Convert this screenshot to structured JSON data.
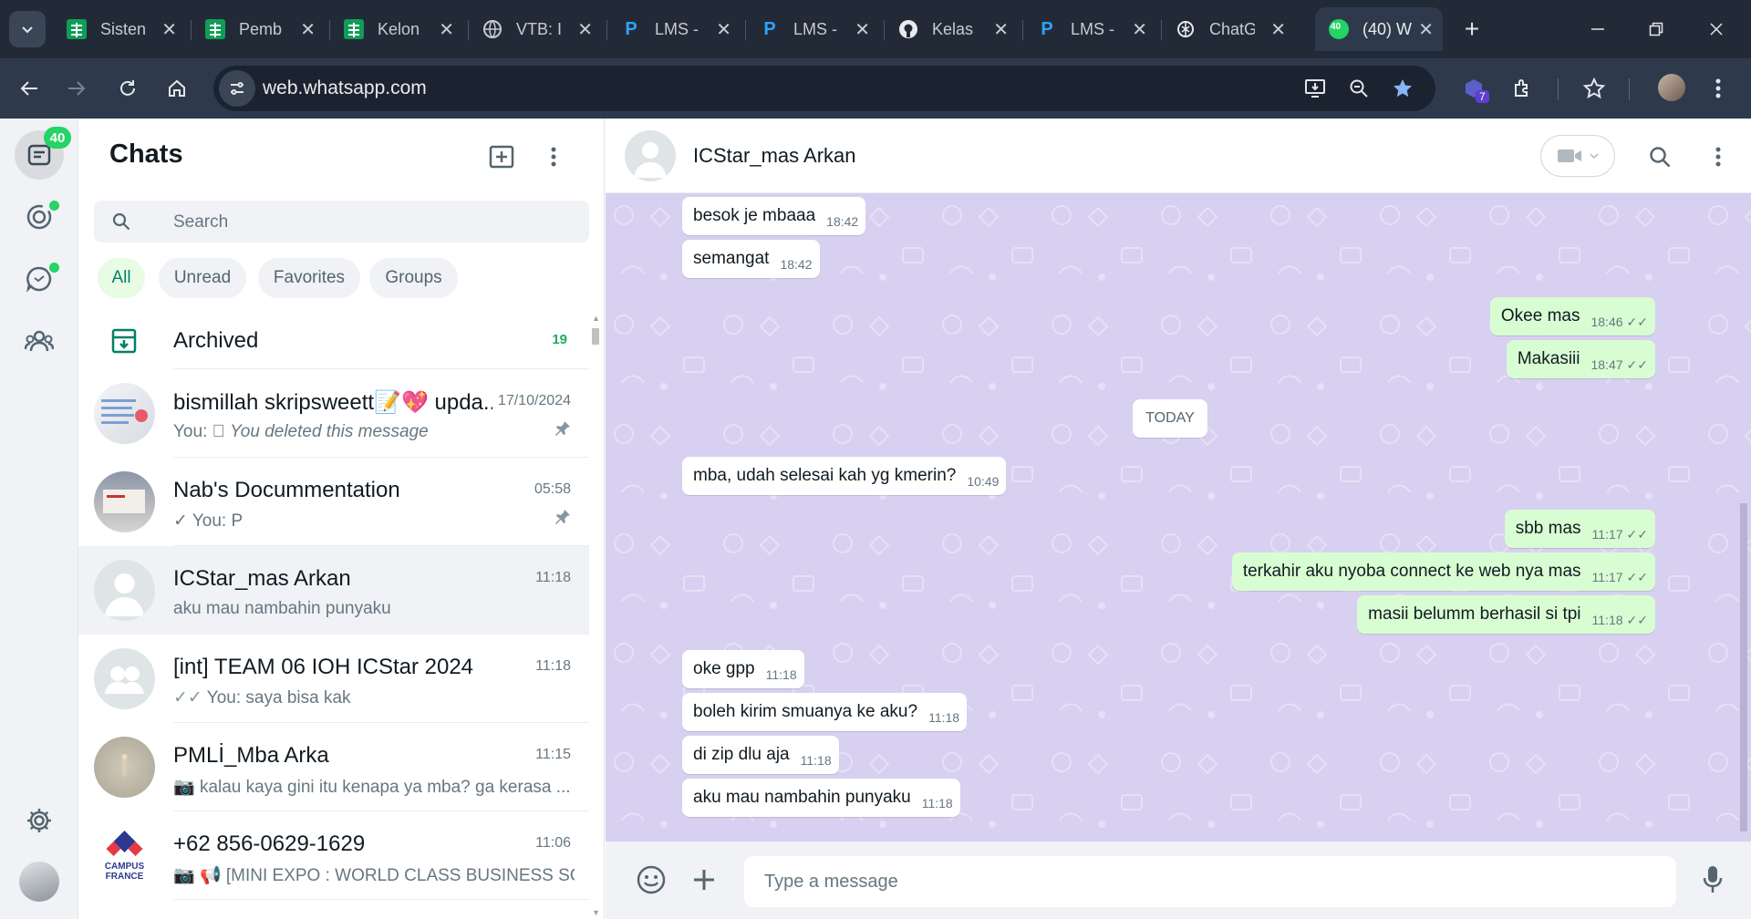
{
  "browser": {
    "tabs": [
      {
        "label": "Sisten",
        "icon": "sheets-icon"
      },
      {
        "label": "Pemb",
        "icon": "sheets-icon"
      },
      {
        "label": "Kelon",
        "icon": "sheets-icon"
      },
      {
        "label": "VTB: I",
        "icon": "globe-icon"
      },
      {
        "label": "LMS -",
        "icon": "lms-icon"
      },
      {
        "label": "LMS -",
        "icon": "lms-icon"
      },
      {
        "label": "Kelas",
        "icon": "github-icon"
      },
      {
        "label": "LMS -",
        "icon": "lms-icon"
      },
      {
        "label": "ChatG",
        "icon": "chatgpt-icon"
      },
      {
        "label": "(40) W",
        "icon": "whatsapp-icon",
        "badge": "40"
      }
    ],
    "url": "web.whatsapp.com",
    "extension_badge": "7"
  },
  "rail": {
    "chats_badge": "40"
  },
  "sidebar": {
    "title": "Chats",
    "search_placeholder": "Search",
    "filters": [
      "All",
      "Unread",
      "Favorites",
      "Groups"
    ],
    "archived": {
      "label": "Archived",
      "count": "19"
    },
    "chats": [
      {
        "name": "bismillah skripsweett📝💖 upda...",
        "time": "17/10/2024",
        "preview_prefix": "You: ",
        "preview": "You deleted this message",
        "pinned": true
      },
      {
        "name": "Nab's Docummentation",
        "time": "05:58",
        "preview_prefix": "You: ",
        "preview": "P",
        "pinned": true
      },
      {
        "name": "ICStar_mas Arkan",
        "time": "11:18",
        "preview_prefix": "",
        "preview": "aku mau nambahin punyaku",
        "selected": true
      },
      {
        "name": "[int] TEAM 06 IOH ICStar 2024",
        "time": "11:18",
        "preview_prefix": "You: ",
        "preview": "saya bisa kak"
      },
      {
        "name": "PMLİ_Mba Arka",
        "time": "11:15",
        "preview_prefix": "",
        "preview": "kalau kaya gini itu kenapa ya mba? ga kerasa ..."
      },
      {
        "name": "+62 856-0629-1629",
        "time": "11:06",
        "preview_prefix": "",
        "preview": "📢 [MINI EXPO : WORLD CLASS BUSINESS SC..."
      }
    ]
  },
  "conversation": {
    "contact_name": "ICStar_mas Arkan",
    "date_divider": "TODAY",
    "input_placeholder": "Type a message",
    "messages": [
      {
        "dir": "in",
        "text": "besok je mbaaa",
        "time": "18:42"
      },
      {
        "dir": "in",
        "text": "semangat",
        "time": "18:42"
      },
      {
        "dir": "out",
        "text": "Okee mas",
        "time": "18:46"
      },
      {
        "dir": "out",
        "text": "Makasiii",
        "time": "18:47"
      },
      {
        "dir": "in",
        "text": "mba, udah selesai kah yg kmerin?",
        "time": "10:49"
      },
      {
        "dir": "out",
        "text": "sbb mas",
        "time": "11:17"
      },
      {
        "dir": "out",
        "text": "terkahir aku nyoba connect ke web nya mas",
        "time": "11:17"
      },
      {
        "dir": "out",
        "text": "masii belumm berhasil si tpi",
        "time": "11:18"
      },
      {
        "dir": "in",
        "text": "oke gpp",
        "time": "11:18"
      },
      {
        "dir": "in",
        "text": "boleh kirim smuanya ke aku?",
        "time": "11:18"
      },
      {
        "dir": "in",
        "text": "di zip dlu aja",
        "time": "11:18"
      },
      {
        "dir": "in",
        "text": "aku mau nambahin punyaku",
        "time": "11:18"
      }
    ]
  },
  "colors": {
    "accent": "#25d366",
    "selected_row": "#f0f2f5",
    "chat_bg": "#d6cdf0",
    "outgoing_bubble": "#d9fdd3"
  }
}
